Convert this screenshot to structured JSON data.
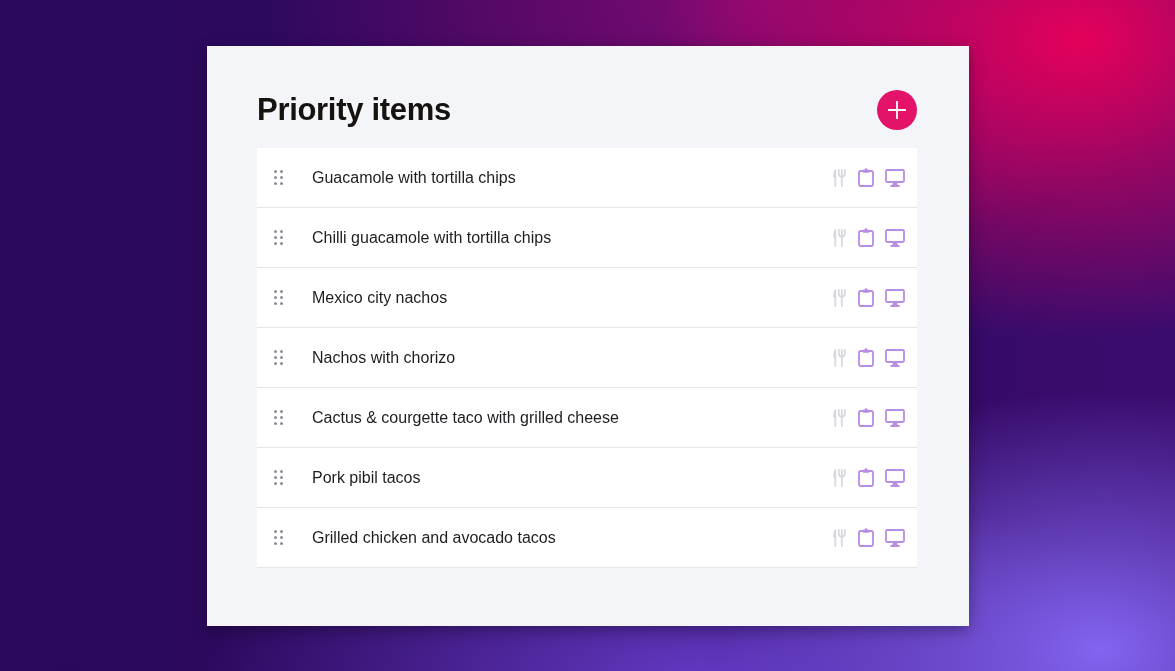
{
  "title": "Priority items",
  "items": [
    {
      "label": "Guacamole with tortilla chips",
      "toggles": [
        {
          "kind": "cutlery",
          "on": false
        },
        {
          "kind": "clipboard",
          "on": true
        },
        {
          "kind": "monitor",
          "on": true
        }
      ]
    },
    {
      "label": "Chilli guacamole with tortilla chips",
      "toggles": [
        {
          "kind": "cutlery",
          "on": false
        },
        {
          "kind": "clipboard",
          "on": true
        },
        {
          "kind": "monitor",
          "on": true
        }
      ]
    },
    {
      "label": "Mexico city nachos",
      "toggles": [
        {
          "kind": "cutlery",
          "on": false
        },
        {
          "kind": "clipboard",
          "on": true
        },
        {
          "kind": "monitor",
          "on": true
        }
      ]
    },
    {
      "label": "Nachos with chorizo",
      "toggles": [
        {
          "kind": "cutlery",
          "on": false
        },
        {
          "kind": "clipboard",
          "on": true
        },
        {
          "kind": "monitor",
          "on": true
        }
      ]
    },
    {
      "label": "Cactus & courgette taco with grilled cheese",
      "toggles": [
        {
          "kind": "cutlery",
          "on": false
        },
        {
          "kind": "clipboard",
          "on": true
        },
        {
          "kind": "monitor",
          "on": true
        }
      ]
    },
    {
      "label": "Pork pibil tacos",
      "toggles": [
        {
          "kind": "cutlery",
          "on": false
        },
        {
          "kind": "clipboard",
          "on": true
        },
        {
          "kind": "monitor",
          "on": true
        }
      ]
    },
    {
      "label": "Grilled chicken and avocado tacos",
      "toggles": [
        {
          "kind": "cutlery",
          "on": false
        },
        {
          "kind": "clipboard",
          "on": true
        },
        {
          "kind": "monitor",
          "on": true
        }
      ]
    }
  ]
}
